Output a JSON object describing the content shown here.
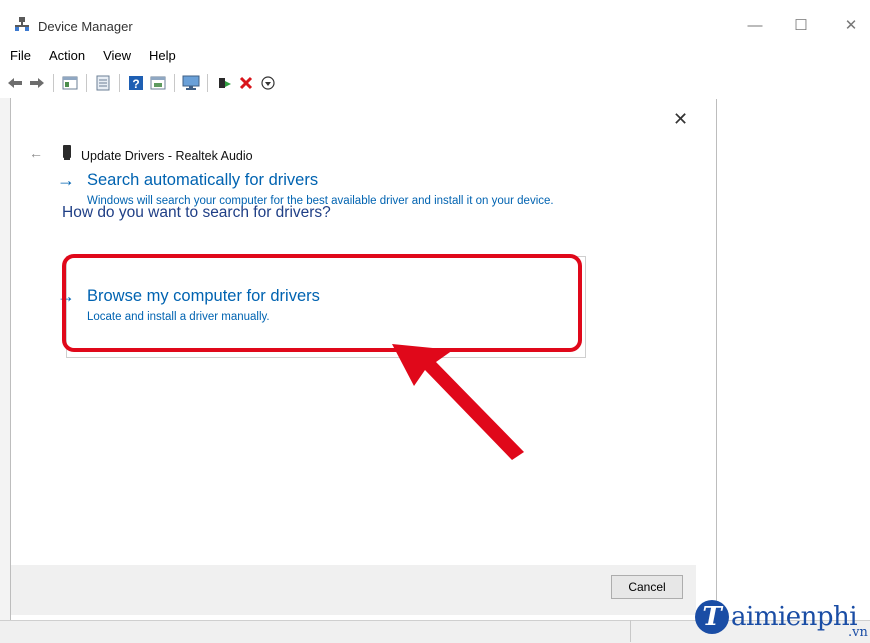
{
  "window": {
    "title": "Device Manager",
    "minimize_glyph": "—",
    "maximize_glyph": "☐",
    "close_glyph": "✕"
  },
  "menu": [
    "File",
    "Action",
    "View",
    "Help"
  ],
  "toolbar": {
    "icons": [
      "back-icon",
      "forward-icon",
      "properties-icon",
      "scan-icon",
      "help-icon",
      "view-icon",
      "monitor-icon",
      "update-driver-icon",
      "uninstall-icon",
      "enable-icon"
    ]
  },
  "dialog": {
    "close_glyph": "✕",
    "back_glyph": "←",
    "heading": "Update Drivers - Realtek Audio",
    "question": "How do you want to search for drivers?",
    "options": [
      {
        "arrow": "→",
        "title": "Search automatically for drivers",
        "description": "Windows will search your computer for the best available driver and install it on your device."
      },
      {
        "arrow": "→",
        "title": "Browse my computer for drivers",
        "description": "Locate and install a driver manually."
      }
    ],
    "cancel_label": "Cancel"
  },
  "watermark": {
    "initial": "T",
    "text": "aimienphi",
    "suffix": ".vn"
  },
  "colors": {
    "link_blue": "#0063b1",
    "heading_blue": "#1f3f86",
    "annotation_red": "#e0081a",
    "watermark_blue": "#1a4da5"
  }
}
